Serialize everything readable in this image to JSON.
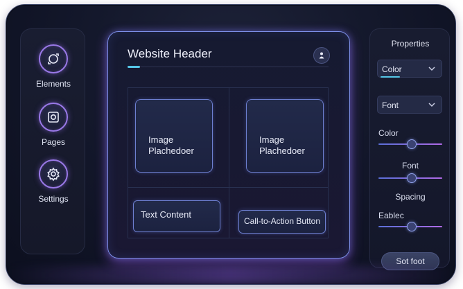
{
  "sidebar": {
    "items": [
      {
        "label": "Elements",
        "icon": "elements-icon"
      },
      {
        "label": "Pages",
        "icon": "pages-icon"
      },
      {
        "label": "Settings",
        "icon": "settings-icon"
      }
    ]
  },
  "canvas": {
    "title": "Website Header",
    "image_placeholders": [
      "Image\nPlachedoer",
      "Image\nPlachedoer"
    ],
    "text_content": "Text Content",
    "cta_button": "Call-to-Action Button"
  },
  "properties": {
    "title": "Properties",
    "color_select": "Color",
    "font_select": "Font",
    "color_label": "Color",
    "font_label": "Font",
    "spacing_label": "Spacing",
    "eablec_label": "Eablec",
    "sliders": {
      "color": 0.52,
      "font": 0.52,
      "eablec": 0.52
    },
    "set_button": "Sot foot"
  },
  "colors": {
    "accent_cyan": "#56c7e8",
    "accent_purple": "#9a79e8",
    "glow_blue": "#7d8fe8"
  }
}
